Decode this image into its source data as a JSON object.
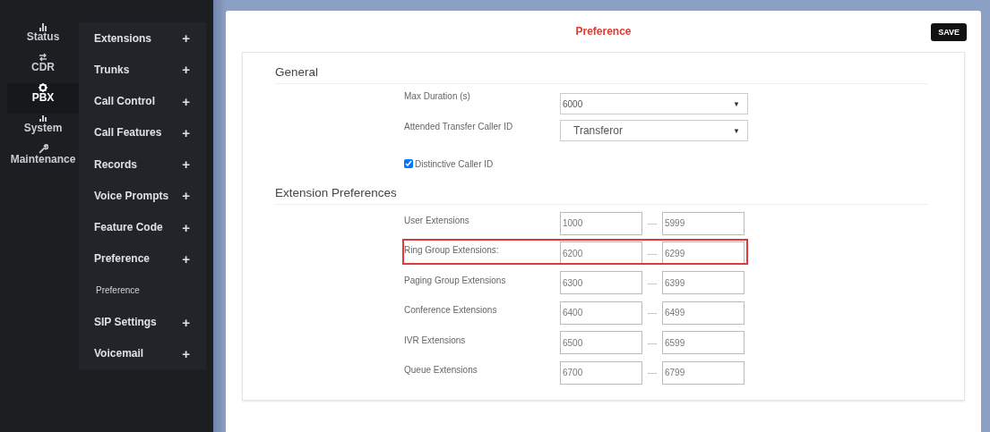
{
  "nav": [
    {
      "label": "Status",
      "selected": false
    },
    {
      "label": "CDR",
      "selected": false
    },
    {
      "label": "PBX",
      "selected": true
    },
    {
      "label": "System",
      "selected": false
    },
    {
      "label": "Maintenance",
      "selected": false
    }
  ],
  "menu": [
    {
      "label": "Extensions",
      "expand": "+"
    },
    {
      "label": "Trunks",
      "expand": "+"
    },
    {
      "label": "Call Control",
      "expand": "+"
    },
    {
      "label": "Call Features",
      "expand": "+"
    },
    {
      "label": "Records",
      "expand": "+"
    },
    {
      "label": "Voice Prompts",
      "expand": "+"
    },
    {
      "label": "Feature Code",
      "expand": "+"
    },
    {
      "label": "Preference",
      "expand": "+",
      "children": [
        {
          "label": "Preference"
        }
      ]
    },
    {
      "label": "SIP Settings",
      "expand": "+"
    },
    {
      "label": "Voicemail",
      "expand": "+"
    }
  ],
  "page": {
    "title": "Preference",
    "save_button": "SAVE"
  },
  "general": {
    "heading": "General",
    "fields": [
      {
        "kind": "select",
        "label": "Max Duration (s)",
        "value": "6000",
        "caret": "▼"
      },
      {
        "kind": "select_large",
        "label": "Attended Transfer Caller ID",
        "value": "Transferor",
        "caret": "▼"
      },
      {
        "kind": "checkbox",
        "label": "Distinctive Caller ID",
        "checked": true
      }
    ]
  },
  "extension_preferences": {
    "heading": "Extension Preferences",
    "rows": [
      {
        "label": "User Extensions",
        "from": "1000",
        "separator": "----",
        "to": "5999",
        "highlighted": false
      },
      {
        "label": "Ring Group Extensions:",
        "from": "6200",
        "separator": "----",
        "to": "6299",
        "highlighted": true
      },
      {
        "label": "Paging Group Extensions",
        "from": "6300",
        "separator": "----",
        "to": "6399",
        "highlighted": false
      },
      {
        "label": "Conference Extensions",
        "from": "6400",
        "separator": "----",
        "to": "6499",
        "highlighted": false
      },
      {
        "label": "IVR Extensions",
        "from": "6500",
        "separator": "----",
        "to": "6599",
        "highlighted": false
      },
      {
        "label": "Queue Extensions",
        "from": "6700",
        "separator": "----",
        "to": "6799",
        "highlighted": false
      }
    ]
  }
}
